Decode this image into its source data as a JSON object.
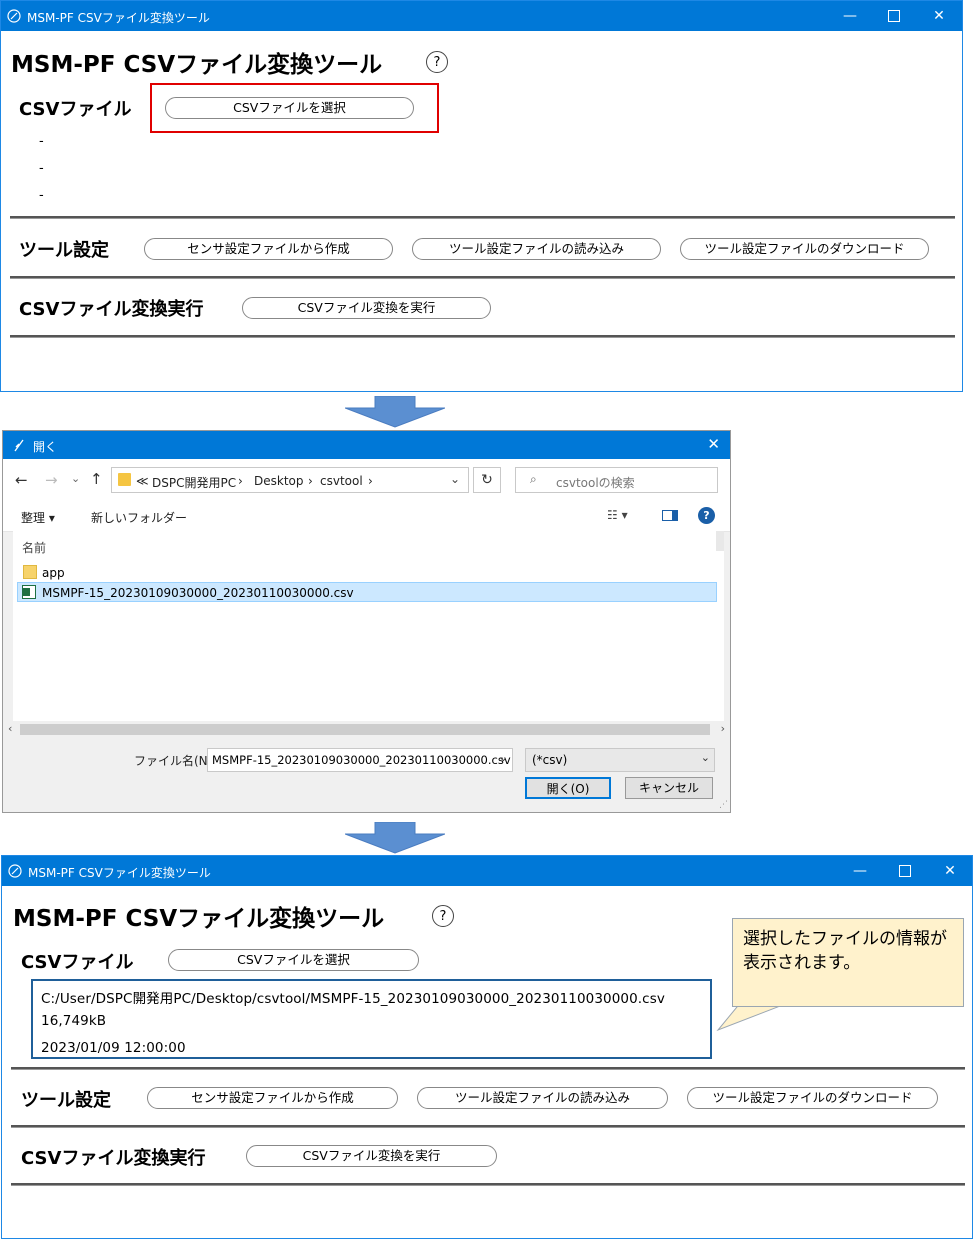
{
  "top_window": {
    "title": "MSM-PF CSVファイル変換ツール",
    "heading": "MSM-PF CSVファイル変換ツール",
    "help": "?",
    "csv_section_label": "CSVファイル",
    "select_button": "CSVファイルを選択",
    "file_info": [
      "-",
      "-",
      "-"
    ],
    "tool_section_label": "ツール設定",
    "tool_buttons": [
      "センサ設定ファイルから作成",
      "ツール設定ファイルの読み込み",
      "ツール設定ファイルのダウンロード"
    ],
    "convert_section_label": "CSVファイル変換実行",
    "convert_button": "CSVファイル変換を実行",
    "highlight_color": "#e00000"
  },
  "dialog": {
    "title": "開く",
    "breadcrumb": [
      "≪",
      "DSPC開発用PC",
      "›",
      "Desktop",
      "›",
      "csvtool",
      "›"
    ],
    "search_placeholder": "csvtoolの検索",
    "organize": "整理 ▾",
    "new_folder": "新しいフォルダー",
    "column_header": "名前",
    "items": [
      {
        "name": "app",
        "icon": "folder-icon",
        "selected": false
      },
      {
        "name": "MSMPF-15_20230109030000_20230110030000.csv",
        "icon": "excel-csv-icon",
        "selected": true
      }
    ],
    "filename_label": "ファイル名(N):",
    "filename_value": "MSMPF-15_20230109030000_20230110030000.csv",
    "filter_value": "(*csv)",
    "open_button": "開く(O)",
    "cancel_button": "キャンセル"
  },
  "bottom_window": {
    "title": "MSM-PF CSVファイル変換ツール",
    "heading": "MSM-PF CSVファイル変換ツール",
    "help": "?",
    "csv_section_label": "CSVファイル",
    "select_button": "CSVファイルを選択",
    "file_info": [
      "C:/User/DSPC開発用PC/Desktop/csvtool/MSMPF-15_20230109030000_20230110030000.csv",
      "16,749kB",
      "2023/01/09 12:00:00"
    ],
    "tool_section_label": "ツール設定",
    "tool_buttons": [
      "センサ設定ファイルから作成",
      "ツール設定ファイルの読み込み",
      "ツール設定ファイルのダウンロード"
    ],
    "convert_section_label": "CSVファイル変換実行",
    "convert_button": "CSVファイル変換を実行",
    "info_box_color": "#1f5f99",
    "callout_text_1": "選択したファイルの情報が",
    "callout_text_2": "表示されます。"
  },
  "colors": {
    "titlebar": "#0078d7",
    "arrow": "#5b8fd1",
    "callout_bg": "#fff2cc",
    "selection": "#cce8ff"
  }
}
